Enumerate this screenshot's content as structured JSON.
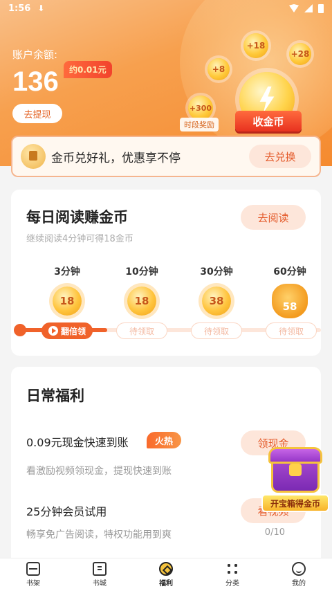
{
  "status_bar": {
    "time": "1:56",
    "download_icon": "download-arrow-icon"
  },
  "header": {
    "balance_label": "账户余额:",
    "balance_value": "136",
    "approx_value": "约0.01元",
    "withdraw_label": "去提现",
    "bubbles": [
      "+18",
      "+28",
      "+8",
      "+300"
    ],
    "timed_reward_label": "时段奖励",
    "collect_label": "收金币"
  },
  "exchange": {
    "text": "金币兑好礼，优惠享不停",
    "button": "去兑换"
  },
  "reading": {
    "title": "每日阅读赚金币",
    "subtitle": "继续阅读4分钟可得18金币",
    "go_button": "去阅读",
    "progress_fraction": 0.3,
    "steps": [
      {
        "minutes": "3分钟",
        "coins": "18",
        "claim": "翻倍领",
        "active": true
      },
      {
        "minutes": "10分钟",
        "coins": "18",
        "claim": "待领取",
        "active": false
      },
      {
        "minutes": "30分钟",
        "coins": "38",
        "claim": "待领取",
        "active": false
      },
      {
        "minutes": "60分钟",
        "coins": "58",
        "claim": "待领取",
        "active": false
      }
    ]
  },
  "daily": {
    "title": "日常福利",
    "tasks": [
      {
        "name": "0.09元现金快速到账",
        "badge": "火热",
        "desc": "看激励视频领现金，提现快速到账",
        "button": "领现金",
        "count": "0/"
      },
      {
        "name": "25分钟会员试用",
        "desc": "畅享免广告阅读，特权功能用到爽",
        "button": "看视频",
        "count": "0/10"
      }
    ]
  },
  "treasure": {
    "label": "开宝箱得金币"
  },
  "tabs": [
    {
      "label": "书架",
      "icon": "bookshelf-icon"
    },
    {
      "label": "书城",
      "icon": "bookstore-icon"
    },
    {
      "label": "福利",
      "icon": "welfare-icon"
    },
    {
      "label": "分类",
      "icon": "category-icon"
    },
    {
      "label": "我的",
      "icon": "profile-icon"
    }
  ]
}
